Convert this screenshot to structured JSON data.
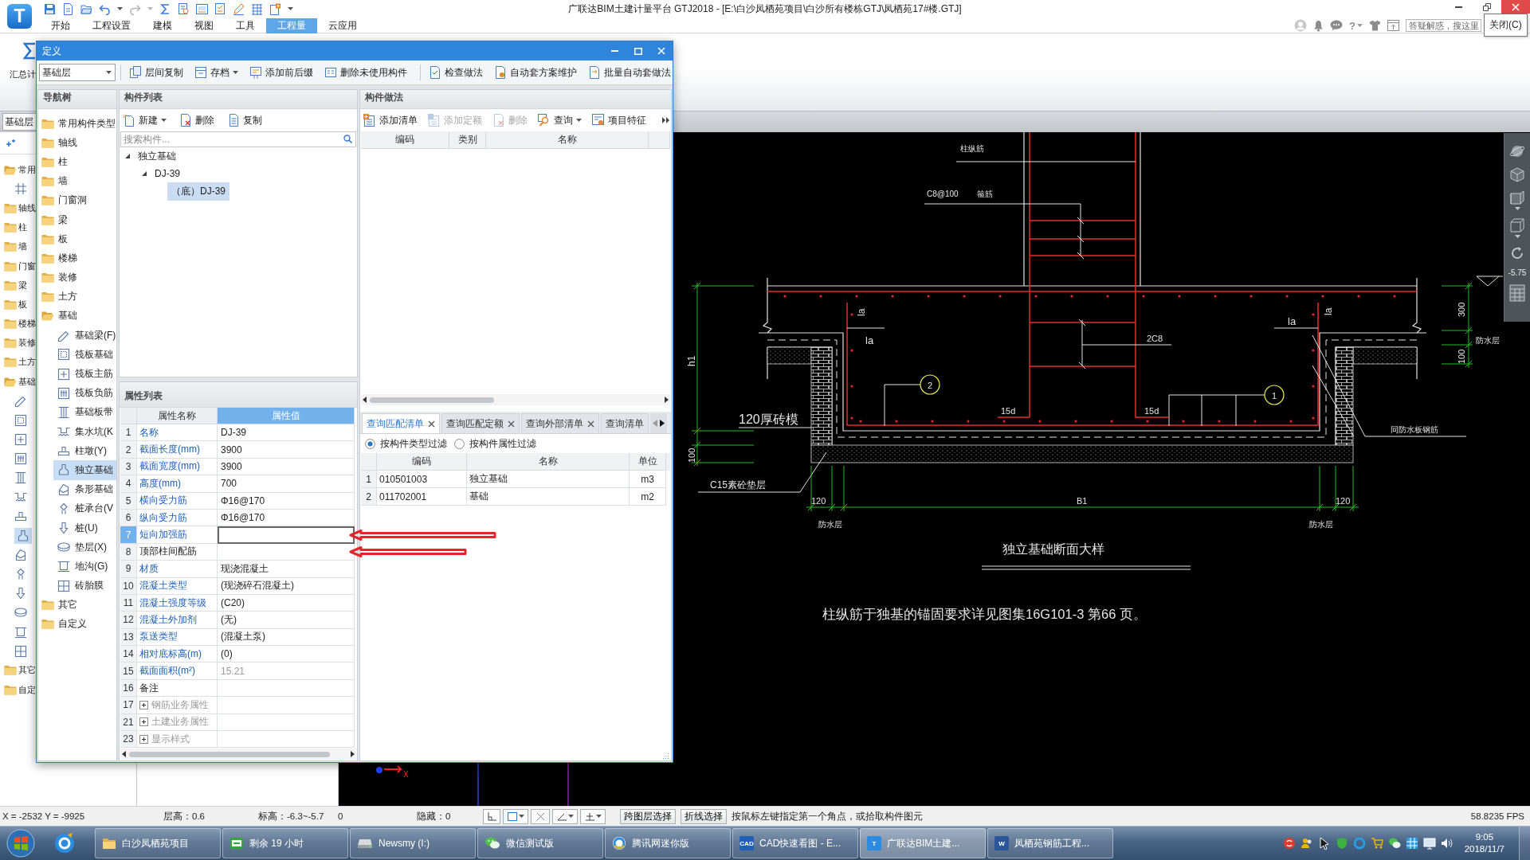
{
  "app": {
    "logo": "T",
    "title": "广联达BIM土建计量平台 GTJ2018 - [E:\\白沙凤栖苑项目\\白沙所有楼栋GTJ\\凤栖苑17#楼.GTJ]",
    "help": "?",
    "search": {
      "placeholder": "答疑解惑，搜这里"
    },
    "tooltip": "关闭(C)"
  },
  "menu_tabs": [
    {
      "label": "开始",
      "selected": false
    },
    {
      "label": "工程设置",
      "selected": false
    },
    {
      "label": "建模",
      "selected": false
    },
    {
      "label": "视图",
      "selected": false
    },
    {
      "label": "工具",
      "selected": false
    },
    {
      "label": "工程量",
      "selected": true
    },
    {
      "label": "云应用",
      "selected": false
    }
  ],
  "ribbon": {
    "label": "汇总计"
  },
  "main_nav": {
    "floor": "基础层",
    "items": [
      {
        "label": "常用",
        "expanded": true,
        "selected": false,
        "children": [
          {
            "kind": "axis-grid",
            "selected": false
          }
        ]
      },
      {
        "label": "轴线",
        "expanded": false,
        "selected": false
      },
      {
        "label": "柱",
        "expanded": false,
        "selected": false
      },
      {
        "label": "墙",
        "expanded": false,
        "selected": false
      },
      {
        "label": "门窗",
        "expanded": false,
        "selected": false
      },
      {
        "label": "梁",
        "expanded": false,
        "selected": false
      },
      {
        "label": "板",
        "expanded": false,
        "selected": false
      },
      {
        "label": "楼梯",
        "expanded": false,
        "selected": false
      },
      {
        "label": "装修",
        "expanded": false,
        "selected": false
      },
      {
        "label": "土方",
        "expanded": false,
        "selected": false
      },
      {
        "label": "基础",
        "expanded": true,
        "selected": false,
        "children": [
          {
            "kind": "beam",
            "selected": false
          },
          {
            "kind": "raft",
            "selected": false
          },
          {
            "kind": "raft-main-rebar",
            "selected": false
          },
          {
            "kind": "raft-neg-rebar",
            "selected": false
          },
          {
            "kind": "slab-band",
            "selected": false
          },
          {
            "kind": "pit",
            "selected": false
          },
          {
            "kind": "pier",
            "selected": false
          },
          {
            "kind": "footing",
            "selected": true
          },
          {
            "kind": "strip-footing",
            "selected": false
          },
          {
            "kind": "pile-cap",
            "selected": false
          },
          {
            "kind": "pile",
            "selected": false
          },
          {
            "kind": "cushion",
            "selected": false
          },
          {
            "kind": "trench",
            "selected": false
          },
          {
            "kind": "brick-mold",
            "selected": false
          }
        ]
      },
      {
        "label": "其它",
        "expanded": false,
        "selected": false
      },
      {
        "label": "自定",
        "expanded": false,
        "selected": false
      }
    ]
  },
  "dialog": {
    "title": "定义",
    "floor": "基础层",
    "toolbar_groups": [
      {
        "items": [
          {
            "label": "层间复制",
            "has_menu": false
          },
          {
            "label": "存档",
            "has_menu": true
          },
          {
            "label": "添加前后缀",
            "has_menu": false
          },
          {
            "label": "删除未使用构件",
            "has_menu": false
          }
        ]
      },
      {
        "items": [
          {
            "label": "检查做法",
            "has_menu": false
          },
          {
            "label": "自动套方案维护",
            "has_menu": false
          },
          {
            "label": "批量自动套做法",
            "has_menu": false
          }
        ]
      }
    ],
    "nav": {
      "title": "导航树",
      "items": [
        {
          "label": "常用构件类型",
          "expanded": false,
          "selected": false
        },
        {
          "label": "轴线",
          "expanded": false,
          "selected": false
        },
        {
          "label": "柱",
          "expanded": false,
          "selected": false
        },
        {
          "label": "墙",
          "expanded": false,
          "selected": false
        },
        {
          "label": "门窗洞",
          "expanded": false,
          "selected": false
        },
        {
          "label": "梁",
          "expanded": false,
          "selected": false
        },
        {
          "label": "板",
          "expanded": false,
          "selected": false
        },
        {
          "label": "楼梯",
          "expanded": false,
          "selected": false
        },
        {
          "label": "装修",
          "expanded": false,
          "selected": false
        },
        {
          "label": "土方",
          "expanded": false,
          "selected": false
        },
        {
          "label": "基础",
          "expanded": true,
          "selected": false,
          "children": [
            {
              "label": "基础梁(F)",
              "kind": "beam",
              "selected": false
            },
            {
              "label": "筏板基础",
              "kind": "raft",
              "selected": false
            },
            {
              "label": "筏板主筋",
              "kind": "raft-main-rebar",
              "selected": false
            },
            {
              "label": "筏板负筋",
              "kind": "raft-neg-rebar",
              "selected": false
            },
            {
              "label": "基础板带",
              "kind": "slab-band",
              "selected": false
            },
            {
              "label": "集水坑(K",
              "kind": "pit",
              "selected": false
            },
            {
              "label": "柱墩(Y)",
              "kind": "pier",
              "selected": false
            },
            {
              "label": "独立基础",
              "kind": "footing",
              "selected": true
            },
            {
              "label": "条形基础",
              "kind": "strip-footing",
              "selected": false
            },
            {
              "label": "桩承台(V",
              "kind": "pile-cap",
              "selected": false
            },
            {
              "label": "桩(U)",
              "kind": "pile",
              "selected": false
            },
            {
              "label": "垫层(X)",
              "kind": "cushion",
              "selected": false
            },
            {
              "label": "地沟(G)",
              "kind": "trench",
              "selected": false
            },
            {
              "label": "砖胎膜",
              "kind": "brick-mold",
              "selected": false
            }
          ]
        },
        {
          "label": "其它",
          "expanded": false,
          "selected": false
        },
        {
          "label": "自定义",
          "expanded": false,
          "selected": false
        }
      ]
    },
    "components": {
      "title": "构件列表",
      "toolbar": [
        {
          "label": "新建",
          "has_menu": true
        },
        {
          "label": "删除",
          "has_menu": false
        },
        {
          "label": "复制",
          "has_menu": false
        }
      ],
      "search": {
        "placeholder": "搜索构件..."
      },
      "tree": [
        {
          "label": "独立基础",
          "expanded": true,
          "selected": false,
          "children": [
            {
              "label": "DJ-39",
              "expanded": true,
              "selected": false,
              "children": [
                {
                  "label": "（底）DJ-39",
                  "selected": true
                }
              ]
            }
          ]
        }
      ]
    },
    "properties": {
      "title": "属性列表",
      "columns": [
        {
          "label": "属性名称",
          "selected": false
        },
        {
          "label": "属性值",
          "selected": true
        }
      ],
      "rows": [
        {
          "num": "1",
          "name": "名称",
          "value": "DJ-39",
          "kind": "public",
          "selected": false,
          "arrow": false
        },
        {
          "num": "2",
          "name": "截面长度(mm)",
          "value": "3900",
          "kind": "public",
          "selected": false,
          "arrow": false
        },
        {
          "num": "3",
          "name": "截面宽度(mm)",
          "value": "3900",
          "kind": "public",
          "selected": false,
          "arrow": false
        },
        {
          "num": "4",
          "name": "高度(mm)",
          "value": "700",
          "kind": "public",
          "selected": false,
          "arrow": false
        },
        {
          "num": "5",
          "name": "横向受力筋",
          "value": "Φ16@170",
          "kind": "public",
          "selected": false,
          "arrow": false
        },
        {
          "num": "6",
          "name": "纵向受力筋",
          "value": "Φ16@170",
          "kind": "public",
          "selected": false,
          "arrow": false
        },
        {
          "num": "7",
          "name": "短向加强筋",
          "kind": "public",
          "selected": true,
          "arrow": true
        },
        {
          "num": "8",
          "name": "顶部柱间配筋",
          "kind": "private",
          "selected": false,
          "arrow": true
        },
        {
          "num": "9",
          "name": "材质",
          "value": "现浇混凝土",
          "kind": "public",
          "selected": false,
          "arrow": false
        },
        {
          "num": "10",
          "name": "混凝土类型",
          "value": "(现浇碎石混凝土)",
          "kind": "public",
          "selected": false,
          "arrow": false
        },
        {
          "num": "11",
          "name": "混凝土强度等级",
          "value": "(C20)",
          "kind": "public",
          "selected": false,
          "arrow": false
        },
        {
          "num": "12",
          "name": "混凝土外加剂",
          "value": "(无)",
          "kind": "public",
          "selected": false,
          "arrow": false
        },
        {
          "num": "13",
          "name": "泵送类型",
          "value": "(混凝土泵)",
          "kind": "public",
          "selected": false,
          "arrow": false
        },
        {
          "num": "14",
          "name": "相对底标高(m)",
          "value": "(0)",
          "kind": "public",
          "selected": false,
          "arrow": false
        },
        {
          "num": "15",
          "name": "截面面积(m²)",
          "value": "15.21",
          "kind": "computed",
          "selected": false,
          "arrow": false
        },
        {
          "num": "16",
          "name": "备注",
          "kind": "private",
          "selected": false,
          "arrow": false
        },
        {
          "num": "17",
          "name": "钢筋业务属性",
          "kind": "group",
          "expanded": false,
          "selected": false,
          "arrow": false
        },
        {
          "num": "21",
          "name": "土建业务属性",
          "kind": "group",
          "expanded": false,
          "selected": false,
          "arrow": false
        },
        {
          "num": "23",
          "name": "显示样式",
          "kind": "group",
          "expanded": false,
          "selected": false,
          "arrow": false
        }
      ]
    },
    "methods": {
      "title": "构件做法",
      "toolbar": [
        {
          "label": "添加清单",
          "disabled": false,
          "has_menu": false
        },
        {
          "label": "添加定额",
          "disabled": true,
          "has_menu": false
        },
        {
          "label": "删除",
          "disabled": true,
          "has_menu": false
        },
        {
          "label": "查询",
          "disabled": false,
          "has_menu": true
        },
        {
          "label": "项目特征",
          "disabled": false,
          "has_menu": false
        }
      ],
      "columns": [
        "编码",
        "类别",
        "名称"
      ]
    },
    "query": {
      "tabs": [
        {
          "label": "查询匹配清单",
          "selected": true,
          "closable": true
        },
        {
          "label": "查询匹配定额",
          "selected": false,
          "closable": true
        },
        {
          "label": "查询外部清单",
          "selected": false,
          "closable": true
        },
        {
          "label": "查询清单",
          "selected": false,
          "closable": false
        }
      ],
      "filters": [
        {
          "label": "按构件类型过滤",
          "selected": true
        },
        {
          "label": "按构件属性过滤",
          "selected": false
        }
      ],
      "columns": [
        "编码",
        "名称",
        "单位"
      ],
      "rows": [
        {
          "num": "1",
          "code": "010501003",
          "name": "独立基础",
          "unit": "m3"
        },
        {
          "num": "2",
          "code": "011702001",
          "name": "基础",
          "unit": "m2"
        }
      ]
    }
  },
  "canvas": {
    "labels": [
      {
        "text": "柱纵筋",
        "kind": "text"
      },
      {
        "text": "C8@100",
        "kind": "text"
      },
      {
        "text": "箍筋",
        "kind": "text"
      },
      {
        "text": "la",
        "kind": "text"
      },
      {
        "text": "la",
        "kind": "text"
      },
      {
        "text": "la",
        "kind": "text"
      },
      {
        "text": "300",
        "kind": "text"
      },
      {
        "text": "la",
        "kind": "text"
      },
      {
        "text": "2C8",
        "kind": "text"
      },
      {
        "text": "防水层",
        "kind": "text"
      },
      {
        "text": "h1",
        "kind": "text"
      },
      {
        "text": "100",
        "kind": "text"
      },
      {
        "text": "2",
        "kind": "callout"
      },
      {
        "text": "1",
        "kind": "callout"
      },
      {
        "text": "15d",
        "kind": "text"
      },
      {
        "text": "15d",
        "kind": "text"
      },
      {
        "text": "120厚砖模",
        "kind": "text"
      },
      {
        "text": "同防水板钢筋",
        "kind": "text"
      },
      {
        "text": "100",
        "kind": "text"
      },
      {
        "text": "C15素砼垫层",
        "kind": "text"
      },
      {
        "text": "120",
        "kind": "text"
      },
      {
        "text": "B1",
        "kind": "text"
      },
      {
        "text": "120",
        "kind": "text"
      },
      {
        "text": "防水层",
        "kind": "text"
      },
      {
        "text": "防水层",
        "kind": "text"
      },
      {
        "text": "独立基础断面大样",
        "kind": "text"
      },
      {
        "text": "柱纵筋于独基的锚固要求详见图集16G101-3 第66 页。",
        "kind": "text"
      }
    ],
    "elevation": "-5.75",
    "axis_label": "X"
  },
  "status_bar": {
    "coords": "X = -2532 Y = -9925",
    "floor_height": "层高：0.6",
    "elevation": "标高：-6.3~-5.7",
    "count": "0",
    "hidden": "隐藏：0",
    "buttons": [
      {
        "label": "跨图层选择"
      },
      {
        "label": "折线选择"
      }
    ],
    "prompt": "按鼠标左键指定第一个角点，或拾取构件图元",
    "fps": "58.8235 FPS"
  },
  "taskbar": {
    "tasks": [
      {
        "label": "白沙凤栖苑项目",
        "kind": "folder",
        "selected": false
      },
      {
        "label": "剩余 19 小时",
        "kind": "timer",
        "selected": false
      },
      {
        "label": "Newsmy (I:)",
        "kind": "drive",
        "selected": false
      },
      {
        "label": "微信测试版",
        "kind": "chat",
        "selected": false
      },
      {
        "label": "腾讯网迷你版",
        "kind": "browser",
        "selected": false
      },
      {
        "label": "CAD快速看图 - E...",
        "kind": "cad",
        "icon_text": "CAD",
        "selected": false
      },
      {
        "label": "广联达BIM土建...",
        "kind": "app",
        "icon_text": "T",
        "selected": true
      },
      {
        "label": "凤栖苑钢筋工程...",
        "kind": "document",
        "icon_text": "W",
        "selected": false
      }
    ],
    "time": "9:05",
    "date": "2018/11/7"
  }
}
